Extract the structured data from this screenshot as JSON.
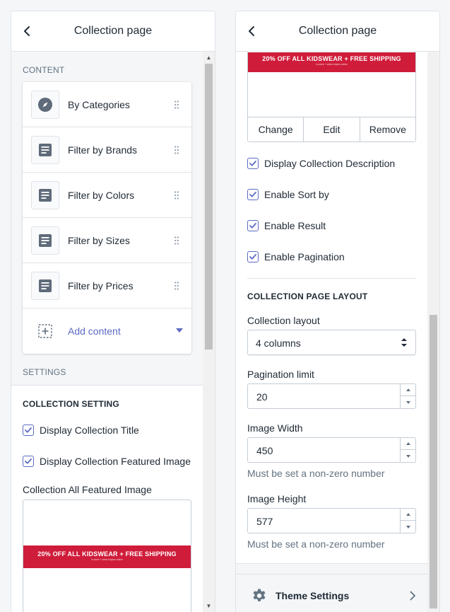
{
  "left": {
    "title": "Collection page",
    "content_label": "CONTENT",
    "blocks": [
      {
        "label": "By Categories",
        "icon": "compass-icon"
      },
      {
        "label": "Filter by Brands",
        "icon": "text-block-icon"
      },
      {
        "label": "Filter by Colors",
        "icon": "text-block-icon"
      },
      {
        "label": "Filter by Sizes",
        "icon": "text-block-icon"
      },
      {
        "label": "Filter by Prices",
        "icon": "text-block-icon"
      }
    ],
    "add_content": "Add content",
    "settings_label": "SETTINGS",
    "collection_setting": "COLLECTION SETTING",
    "check_title": "Display Collection Title",
    "check_featured": "Display Collection Featured Image",
    "featured_image_label": "Collection All Featured Image",
    "banner_text": "20% OFF ALL KIDSWEAR + FREE SHIPPING",
    "banner_subtext": "in-store + select styles online"
  },
  "right": {
    "title": "Collection page",
    "banner_text": "20% OFF ALL KIDSWEAR + FREE SHIPPING",
    "banner_subtext": "in-store + select styles online",
    "change_btn": "Change",
    "edit_btn": "Edit",
    "remove_btn": "Remove",
    "check_description": "Display Collection Description",
    "check_sort": "Enable Sort by",
    "check_result": "Enable Result",
    "check_pagination": "Enable Pagination",
    "layout_heading": "COLLECTION PAGE LAYOUT",
    "layout_label": "Collection layout",
    "layout_value": "4 columns",
    "pagination_label": "Pagination limit",
    "pagination_value": "20",
    "width_label": "Image Width",
    "width_value": "450",
    "width_help": "Must be set a non-zero number",
    "height_label": "Image Height",
    "height_value": "577",
    "height_help": "Must be set a non-zero number",
    "footer_label": "Theme Settings"
  },
  "colors": {
    "accent": "#5c6ac4",
    "banner": "#cf1c3a",
    "icon_dark": "#5f6b7a",
    "border": "#dfe3e8"
  }
}
